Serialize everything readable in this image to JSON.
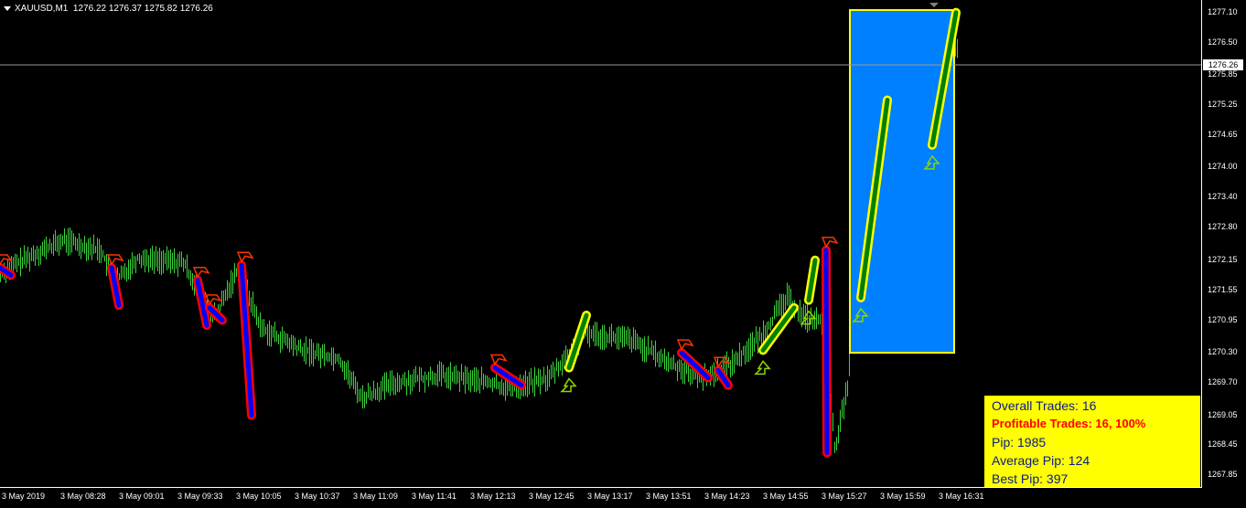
{
  "header": {
    "symbol": "XAUUSD,M1",
    "ohlc": "1276.22 1276.37 1275.82 1276.26"
  },
  "price_axis": {
    "current_price": "1276.26",
    "ticks": [
      "1277.10",
      "1276.50",
      "1275.85",
      "1275.25",
      "1274.65",
      "1274.00",
      "1273.40",
      "1272.80",
      "1272.15",
      "1271.55",
      "1270.95",
      "1270.30",
      "1269.70",
      "1269.05",
      "1268.45",
      "1267.85"
    ]
  },
  "time_axis": {
    "labels": [
      "3 May 2019",
      "3 May 08:28",
      "3 May 09:01",
      "3 May 09:33",
      "3 May 10:05",
      "3 May 10:37",
      "3 May 11:09",
      "3 May 11:41",
      "3 May 12:13",
      "3 May 12:45",
      "3 May 13:17",
      "3 May 13:51",
      "3 May 14:23",
      "3 May 14:55",
      "3 May 15:27",
      "3 May 15:59",
      "3 May 16:31"
    ]
  },
  "stats": {
    "overall": "Overall Trades: 16",
    "profitable": "Profitable Trades: 16, 100%",
    "pip": "Pip: 1985",
    "average": "Average Pip: 124",
    "best": "Best Pip: 397"
  },
  "colors": {
    "background": "#000000",
    "candles": "#3bd43b",
    "sell_trade": "#0000ff",
    "sell_outline": "#ff0000",
    "buy_trade": "#008000",
    "buy_outline": "#ffff00",
    "highlight_box": "#0080ff",
    "stats_bg": "#ffff00"
  },
  "chart_data": {
    "type": "line",
    "ylim": [
      1267.6,
      1277.35
    ],
    "trades": [
      {
        "direction": "sell",
        "from": 1272.0,
        "to": 1271.85
      },
      {
        "direction": "sell",
        "from": 1272.0,
        "to": 1271.25
      },
      {
        "direction": "sell",
        "from": 1271.75,
        "to": 1270.85
      },
      {
        "direction": "sell",
        "from": 1271.2,
        "to": 1270.95
      },
      {
        "direction": "sell",
        "from": 1272.05,
        "to": 1269.05
      },
      {
        "direction": "sell",
        "from": 1270.0,
        "to": 1269.65
      },
      {
        "direction": "buy",
        "from": 1270.0,
        "to": 1271.05
      },
      {
        "direction": "sell",
        "from": 1270.3,
        "to": 1269.8
      },
      {
        "direction": "sell",
        "from": 1269.95,
        "to": 1269.65
      },
      {
        "direction": "buy",
        "from": 1270.35,
        "to": 1271.2
      },
      {
        "direction": "buy",
        "from": 1271.35,
        "to": 1272.15
      },
      {
        "direction": "sell",
        "from": 1272.35,
        "to": 1268.3
      },
      {
        "direction": "buy",
        "from": 1271.4,
        "to": 1275.35
      },
      {
        "direction": "buy",
        "from": 1274.45,
        "to": 1277.1
      }
    ],
    "highlight_range": {
      "price_from": 1270.3,
      "price_to": 1277.15
    }
  }
}
